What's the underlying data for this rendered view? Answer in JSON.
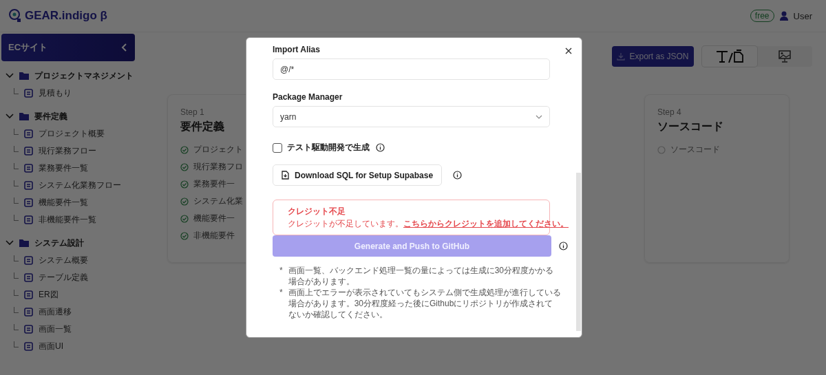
{
  "header": {
    "logo": "GEAR.indigo β",
    "plan_badge": "free",
    "user": "User"
  },
  "sidebar": {
    "project": "ECサイト",
    "sections": [
      {
        "label": "プロジェクトマネジメント",
        "expanded": true,
        "children": [
          {
            "label": "見積もり"
          }
        ]
      },
      {
        "label": "要件定義",
        "expanded": true,
        "children": [
          {
            "label": "プロジェクト概要"
          },
          {
            "label": "現行業務フロー"
          },
          {
            "label": "業務要件一覧"
          },
          {
            "label": "システム化業務フロー"
          },
          {
            "label": "機能要件一覧"
          },
          {
            "label": "非機能要件一覧"
          }
        ]
      },
      {
        "label": "システム設計",
        "expanded": true,
        "children": [
          {
            "label": "システム概要"
          },
          {
            "label": "テーブル定義"
          },
          {
            "label": "ER図"
          },
          {
            "label": "画面遷移"
          },
          {
            "label": "画面一覧"
          },
          {
            "label": "画面UI"
          }
        ]
      }
    ]
  },
  "toolbar": {
    "export_button": "Export as JSON",
    "view_toggles": [
      {
        "selected": true
      },
      {
        "selected": false
      }
    ]
  },
  "steps": [
    {
      "step": "Step 1",
      "title": "要件定義",
      "items": [
        {
          "label": "プロジェクト",
          "done": true
        },
        {
          "label": "現行業務フロ",
          "done": true
        },
        {
          "label": "業務要件一",
          "done": true
        },
        {
          "label": "システム化業",
          "done": true
        },
        {
          "label": "機能要件一",
          "done": true
        },
        {
          "label": "非機能要件",
          "done": true
        }
      ]
    },
    {
      "step": "Step 4",
      "title": "ソースコード",
      "items": [
        {
          "label": "ソースコード",
          "done": false
        }
      ]
    }
  ],
  "modal": {
    "import_alias": {
      "label": "Import Alias",
      "value": "@/*"
    },
    "package_manager": {
      "label": "Package Manager",
      "value": "yarn"
    },
    "tdd_checkbox": {
      "label": "テスト駆動開発で生成",
      "checked": false
    },
    "download_button": "Download SQL for Setup Supabase",
    "alert": {
      "title": "クレジット不足",
      "message": "クレジットが不足しています。",
      "link": "こちらからクレジットを追加してください。"
    },
    "generate_button": {
      "label": "Generate and Push to GitHub",
      "disabled": true
    },
    "notes": [
      {
        "marker": "*",
        "text": "画面一覧、バックエンド処理一覧の量によっては生成に30分程度かかる場合があります。"
      },
      {
        "marker": "*",
        "text": "画面上でエラーが表示されていてもシステム側で生成処理が進行している場合があります。30分程度経った後にGithubにリポジトリが作成されてないか確認してください。"
      }
    ]
  }
}
